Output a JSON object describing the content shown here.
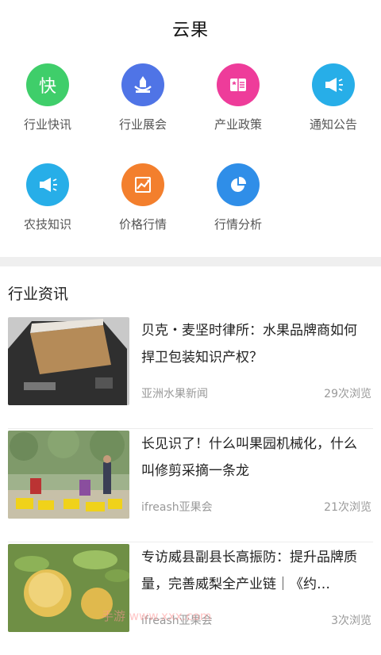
{
  "header": {
    "title": "云果"
  },
  "categories": [
    {
      "label": "行业快讯",
      "glyph": "快",
      "color": "#3fce6a",
      "icon": "flash-news-icon"
    },
    {
      "label": "行业展会",
      "glyph": "",
      "color": "#4f74e6",
      "icon": "exhibition-icon"
    },
    {
      "label": "产业政策",
      "glyph": "",
      "color": "#ee3c9a",
      "icon": "policy-book-icon"
    },
    {
      "label": "通知公告",
      "glyph": "",
      "color": "#27aee8",
      "icon": "megaphone-icon"
    },
    {
      "label": "农技知识",
      "glyph": "",
      "color": "#27aee8",
      "icon": "megaphone-icon"
    },
    {
      "label": "价格行情",
      "glyph": "",
      "color": "#f37f2d",
      "icon": "price-trend-icon"
    },
    {
      "label": "行情分析",
      "glyph": "",
      "color": "#2f8ee8",
      "icon": "pie-chart-icon"
    }
  ],
  "section": {
    "title": "行业资讯"
  },
  "news": [
    {
      "headline": "贝克・麦坚时律所：水果品牌商如何捍卫包装知识产权？",
      "source": "亚洲水果新闻",
      "views": "29次浏览"
    },
    {
      "headline": "长见识了！什么叫果园机械化，什么叫修剪采摘一条龙",
      "source": "ifreash亚果会",
      "views": "21次浏览"
    },
    {
      "headline": "专访威县副县长高振防：提升品牌质量，完善威梨全产业链｜《约…",
      "source": "ifreash亚果会",
      "views": "3次浏览"
    }
  ],
  "watermark": "手游 www.xxx.com"
}
